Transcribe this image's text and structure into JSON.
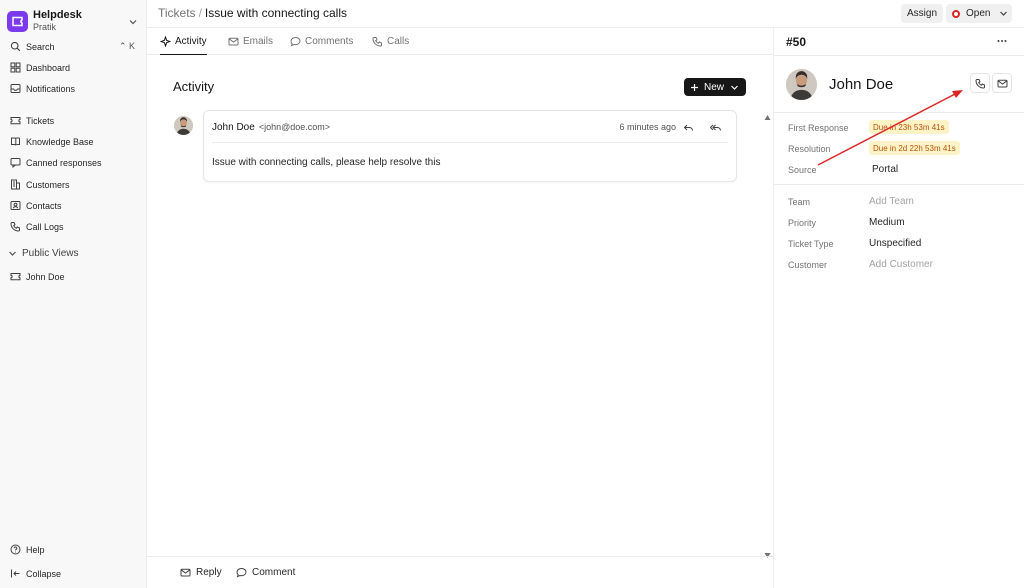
{
  "sidebar": {
    "app_name": "Helpdesk",
    "user": "Pratik",
    "search": {
      "label": "Search",
      "shortcut": "K"
    },
    "items": [
      {
        "label": "Dashboard"
      },
      {
        "label": "Notifications"
      },
      {
        "label": "Tickets"
      },
      {
        "label": "Knowledge Base"
      },
      {
        "label": "Canned responses"
      },
      {
        "label": "Customers"
      },
      {
        "label": "Contacts"
      },
      {
        "label": "Call Logs"
      }
    ],
    "public_views": {
      "label": "Public Views",
      "items": [
        {
          "label": "John Doe"
        }
      ]
    },
    "help_label": "Help",
    "collapse_label": "Collapse"
  },
  "header": {
    "breadcrumb_root": "Tickets",
    "breadcrumb_sep": "/",
    "breadcrumb_current": "Issue with connecting calls",
    "assign_label": "Assign",
    "status_label": "Open"
  },
  "tabs": [
    {
      "label": "Activity",
      "active": true
    },
    {
      "label": "Emails",
      "active": false
    },
    {
      "label": "Comments",
      "active": false
    },
    {
      "label": "Calls",
      "active": false
    }
  ],
  "activity": {
    "title": "Activity",
    "new_label": "New",
    "entry": {
      "author": "John Doe",
      "email": "<john@doe.com>",
      "time": "6 minutes ago",
      "body": "Issue with connecting calls, please help resolve this"
    }
  },
  "footer": {
    "reply_label": "Reply",
    "comment_label": "Comment"
  },
  "ticket": {
    "id": "#50",
    "contact_name": "John Doe",
    "first_response_label": "First Response",
    "first_response_value": "Due in 23h 53m 41s",
    "resolution_label": "Resolution",
    "resolution_value": "Due in 2d 22h 53m 41s",
    "source_label": "Source",
    "source_value": "Portal",
    "team_label": "Team",
    "team_value": "Add Team",
    "priority_label": "Priority",
    "priority_value": "Medium",
    "type_label": "Ticket Type",
    "type_value": "Unspecified",
    "customer_label": "Customer",
    "customer_value": "Add Customer"
  },
  "colors": {
    "brand": "#7c3aed",
    "status_open": "#dc2626",
    "sla_bg": "#fef3c7",
    "sla_text": "#b45309",
    "annotation_arrow": "#dc2626"
  }
}
